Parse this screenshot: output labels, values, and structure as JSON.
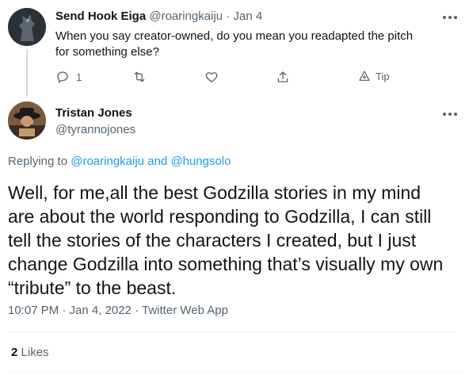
{
  "reply": {
    "author_name": "Send Hook Eiga",
    "author_handle": "@roaringkaiju",
    "separator": "·",
    "date": "Jan 4",
    "text": "When you say creator-owned, do you mean you readapted the pitch for something else?",
    "actions": {
      "reply_count": "1",
      "retweet_count": "",
      "like_count": "",
      "tip_label": "Tip"
    }
  },
  "main": {
    "author_name": "Tristan Jones",
    "author_handle": "@tyrannojones",
    "replying_prefix": "Replying to",
    "replying_to": "@roaringkaiju and @hungsolo",
    "text": "Well, for me,all the best Godzilla stories in my mind are about the world responding to Godzilla, I can still tell the stories of the characters I created, but I just change Godzilla into something that’s visually my own “tribute” to the beast.",
    "timestamp": "10:07 PM · Jan 4, 2022",
    "meta_separator": "·",
    "source": "Twitter Web App",
    "likes_count": "2",
    "likes_label": "Likes"
  },
  "colors": {
    "accent": "#1d9bf0",
    "muted": "#536471",
    "text": "#0f1419",
    "divider": "#eff3f4"
  },
  "icons": {
    "reply": "reply-icon",
    "retweet": "retweet-icon",
    "like": "heart-icon",
    "share": "share-icon",
    "tip": "tip-icon",
    "more": "more-icon"
  }
}
